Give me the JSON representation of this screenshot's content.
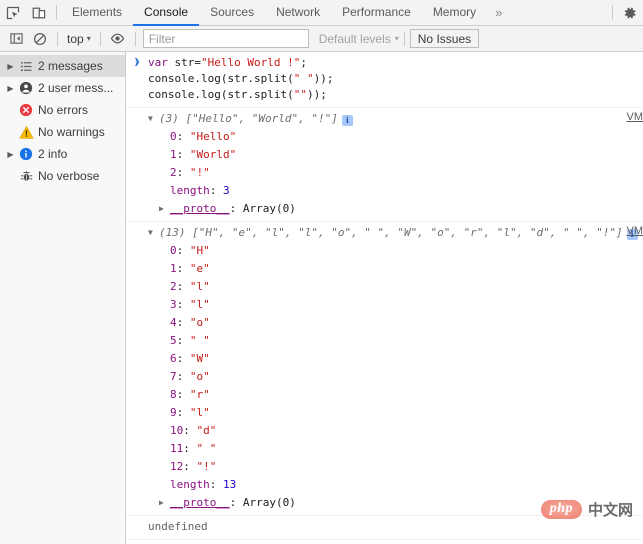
{
  "tabbar": {
    "inspect_icon": "inspect-element-icon",
    "device_icon": "device-toolbar-icon",
    "tabs": [
      {
        "label": "Elements",
        "active": false
      },
      {
        "label": "Console",
        "active": true
      },
      {
        "label": "Sources",
        "active": false
      },
      {
        "label": "Network",
        "active": false
      },
      {
        "label": "Performance",
        "active": false
      },
      {
        "label": "Memory",
        "active": false
      }
    ],
    "more_label": "»",
    "settings_icon": "gear-icon"
  },
  "filterbar": {
    "sidebar_toggle_icon": "show-console-sidebar-icon",
    "clear_icon": "clear-console-icon",
    "context_label": "top",
    "caret": "▾",
    "eye_icon": "live-expression-eye-icon",
    "filter_placeholder": "Filter",
    "filter_value": "",
    "levels_label": "Default levels",
    "issues_label": "No Issues"
  },
  "sidebar": {
    "items": [
      {
        "label": "2 messages",
        "icon": "list-icon",
        "arrow": "▶",
        "selected": true,
        "expandable": true
      },
      {
        "label": "2 user mess...",
        "icon": "user-icon",
        "arrow": "▶",
        "selected": false,
        "expandable": true
      },
      {
        "label": "No errors",
        "icon": "error-icon",
        "arrow": "",
        "selected": false,
        "expandable": false
      },
      {
        "label": "No warnings",
        "icon": "warning-icon",
        "arrow": "",
        "selected": false,
        "expandable": false
      },
      {
        "label": "2 info",
        "icon": "info-icon",
        "arrow": "▶",
        "selected": false,
        "expandable": true
      },
      {
        "label": "No verbose",
        "icon": "verbose-bug-icon",
        "arrow": "",
        "selected": false,
        "expandable": false
      }
    ]
  },
  "console": {
    "input_gutter": "›",
    "output_gutter": "‹",
    "command_lines": [
      {
        "kw": "var ",
        "mid": "str=",
        "str": "\"Hello World !\"",
        "tail": ";"
      },
      {
        "kw": "",
        "mid": "console.log(str.split(",
        "str": "\" \"",
        "tail": "));"
      },
      {
        "kw": "",
        "mid": "console.log(str.split(",
        "str": "\"\"",
        "tail": "));"
      }
    ],
    "logs": [
      {
        "triangle": "▼",
        "count_label": "(3)",
        "preview": "[\"Hello\", \"World\", \"!\"]",
        "info_badge": "i",
        "vm_label": "VM",
        "props": [
          {
            "key": "0",
            "value": "\"Hello\""
          },
          {
            "key": "1",
            "value": "\"World\""
          },
          {
            "key": "2",
            "value": "\"!\""
          }
        ],
        "length_key": "length",
        "length_value": "3",
        "proto_triangle": "▶",
        "proto_key": "__proto__",
        "proto_value": "Array(0)"
      },
      {
        "triangle": "▼",
        "count_label": "(13)",
        "preview": "[\"H\", \"e\", \"l\", \"l\", \"o\", \" \", \"W\", \"o\", \"r\", \"l\", \"d\", \" \", \"!\"]",
        "info_badge": "i",
        "vm_label": "VM",
        "props": [
          {
            "key": "0",
            "value": "\"H\""
          },
          {
            "key": "1",
            "value": "\"e\""
          },
          {
            "key": "2",
            "value": "\"l\""
          },
          {
            "key": "3",
            "value": "\"l\""
          },
          {
            "key": "4",
            "value": "\"o\""
          },
          {
            "key": "5",
            "value": "\" \""
          },
          {
            "key": "6",
            "value": "\"W\""
          },
          {
            "key": "7",
            "value": "\"o\""
          },
          {
            "key": "8",
            "value": "\"r\""
          },
          {
            "key": "9",
            "value": "\"l\""
          },
          {
            "key": "10",
            "value": "\"d\""
          },
          {
            "key": "11",
            "value": "\" \""
          },
          {
            "key": "12",
            "value": "\"!\""
          }
        ],
        "length_key": "length",
        "length_value": "13",
        "proto_triangle": "▶",
        "proto_key": "__proto__",
        "proto_value": "Array(0)"
      }
    ],
    "result_value": "undefined",
    "prompt_gutter": "❯"
  },
  "watermark": {
    "logo_text": "php",
    "site_text": "中文网"
  },
  "colors": {
    "accent": "#1a73e8",
    "string": "#c41a16",
    "keyword": "#881280",
    "number": "#1c00cf",
    "toolbar_bg": "#f3f3f3",
    "sidebar_bg": "#f8f8f8",
    "selected_row": "#dcdcdc"
  }
}
